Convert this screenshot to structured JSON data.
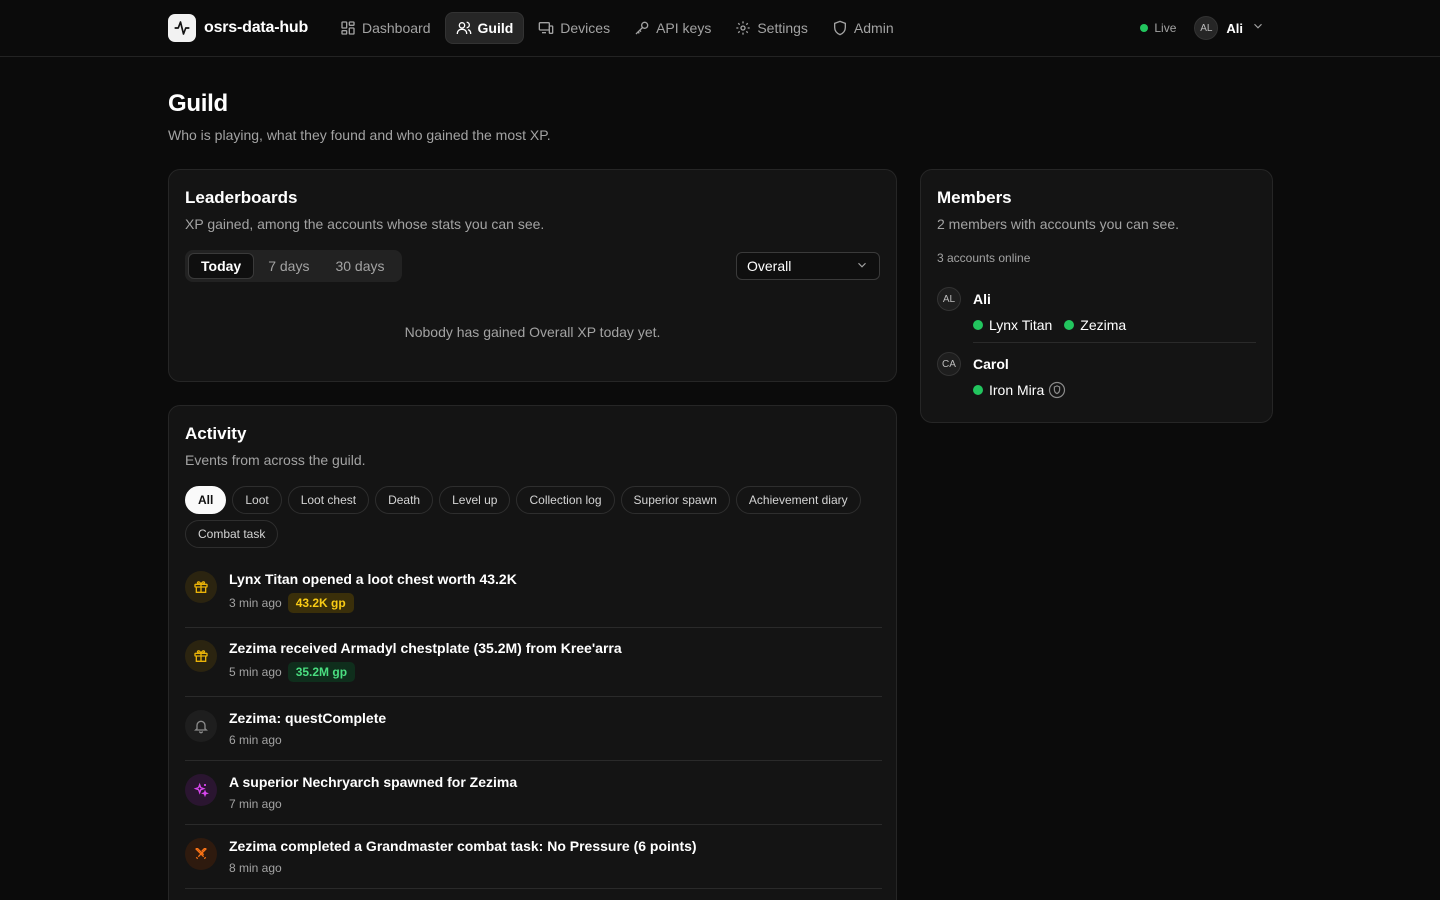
{
  "brand": {
    "name": "osrs-data-hub"
  },
  "nav": [
    {
      "label": "Dashboard",
      "icon": "dashboard-icon"
    },
    {
      "label": "Guild",
      "icon": "users-icon",
      "active": true
    },
    {
      "label": "Devices",
      "icon": "devices-icon"
    },
    {
      "label": "API keys",
      "icon": "key-icon"
    },
    {
      "label": "Settings",
      "icon": "gear-icon"
    },
    {
      "label": "Admin",
      "icon": "shield-icon"
    }
  ],
  "status": {
    "live_label": "Live",
    "color": "#22c55e"
  },
  "user": {
    "initials": "AL",
    "name": "Ali"
  },
  "page": {
    "title": "Guild",
    "subtitle": "Who is playing, what they found and who gained the most XP."
  },
  "leaderboards": {
    "title": "Leaderboards",
    "description": "XP gained, among the accounts whose stats you can see.",
    "ranges": [
      "Today",
      "7 days",
      "30 days"
    ],
    "active_range": "Today",
    "skill": "Overall",
    "empty_message": "Nobody has gained Overall XP today yet."
  },
  "members": {
    "title": "Members",
    "description": "2 members with accounts you can see.",
    "online_count": "3 accounts online",
    "list": [
      {
        "initials": "AL",
        "name": "Ali",
        "accounts": [
          {
            "name": "Lynx Titan",
            "online": true
          },
          {
            "name": "Zezima",
            "online": true
          }
        ]
      },
      {
        "initials": "CA",
        "name": "Carol",
        "accounts": [
          {
            "name": "Iron Mira",
            "online": true,
            "ironman": true
          }
        ]
      }
    ]
  },
  "activity": {
    "title": "Activity",
    "description": "Events from across the guild.",
    "filters": [
      "All",
      "Loot",
      "Loot chest",
      "Death",
      "Level up",
      "Collection log",
      "Superior spawn",
      "Achievement diary",
      "Combat task"
    ],
    "active_filter": "All",
    "events": [
      {
        "title": "Lynx Titan opened a loot chest worth 43.2K",
        "time": "3 min ago",
        "badge": "43.2K gp",
        "badge_color": "#facc15",
        "badge_bg": "#3a2f0a",
        "icon": "gift-icon",
        "icon_color": "#eab308",
        "icon_bg": "#2b2410"
      },
      {
        "title": "Zezima received Armadyl chestplate (35.2M) from Kree'arra",
        "time": "5 min ago",
        "badge": "35.2M gp",
        "badge_color": "#4ade80",
        "badge_bg": "#0f2e1c",
        "icon": "gift-icon",
        "icon_color": "#eab308",
        "icon_bg": "#2b2410"
      },
      {
        "title": "Zezima: questComplete",
        "time": "6 min ago",
        "icon": "bell-icon",
        "icon_color": "#8a8a8a",
        "icon_bg": "#1e1e1e"
      },
      {
        "title": "A superior Nechryarch spawned for Zezima",
        "time": "7 min ago",
        "icon": "sparkles-icon",
        "icon_color": "#d946ef",
        "icon_bg": "#2a1530"
      },
      {
        "title": "Zezima completed a Grandmaster combat task: No Pressure (6 points)",
        "time": "8 min ago",
        "icon": "swords-icon",
        "icon_color": "#f97316",
        "icon_bg": "#2e1a0e"
      }
    ]
  }
}
